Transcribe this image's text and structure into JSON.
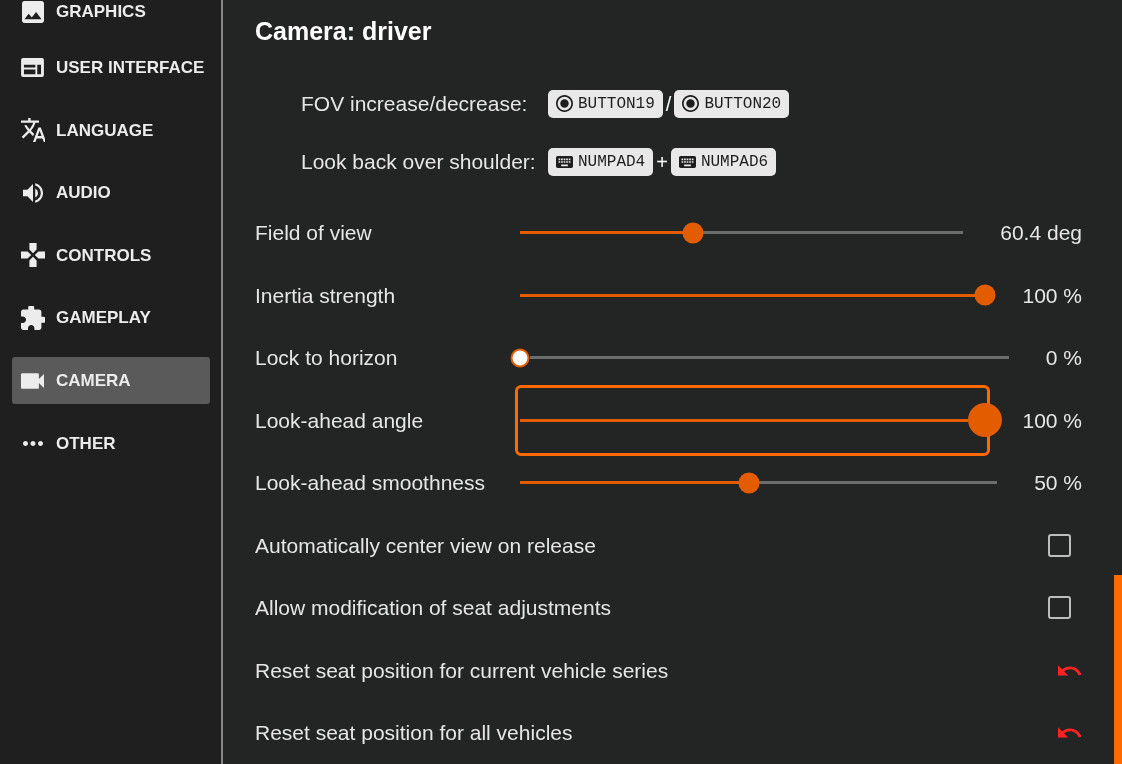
{
  "sidebar": {
    "items": [
      {
        "label": "GRAPHICS",
        "selected": false
      },
      {
        "label": "USER INTERFACE",
        "selected": false
      },
      {
        "label": "LANGUAGE",
        "selected": false
      },
      {
        "label": "AUDIO",
        "selected": false
      },
      {
        "label": "CONTROLS",
        "selected": false
      },
      {
        "label": "GAMEPLAY",
        "selected": false
      },
      {
        "label": "CAMERA",
        "selected": true
      },
      {
        "label": "OTHER",
        "selected": false
      }
    ]
  },
  "section": {
    "title": "Camera: driver"
  },
  "keybindings": [
    {
      "label": "FOV increase/decrease:",
      "keys": [
        {
          "kind": "joystick",
          "label": "BUTTON19"
        },
        {
          "kind": "joystick",
          "label": "BUTTON20"
        }
      ],
      "separator": "/"
    },
    {
      "label": "Look back over shoulder:",
      "keys": [
        {
          "kind": "keyboard",
          "label": "NUMPAD4"
        },
        {
          "kind": "keyboard",
          "label": "NUMPAD6"
        }
      ],
      "separator": "+"
    }
  ],
  "settings": [
    {
      "kind": "slider",
      "label": "Field of view",
      "level": 0.39,
      "reading": "60.4 deg",
      "focused": false
    },
    {
      "kind": "slider",
      "label": "Inertia strength",
      "level": 1,
      "reading": "100 %",
      "focused": false
    },
    {
      "kind": "slider",
      "label": "Lock to horizon",
      "level": 0,
      "reading": "0 %",
      "focused": false
    },
    {
      "kind": "slider",
      "label": "Look-ahead angle",
      "level": 1,
      "reading": "100 %",
      "focused": true
    },
    {
      "kind": "slider",
      "label": "Look-ahead smoothness",
      "level": 0.48,
      "reading": "50 %",
      "focused": false
    },
    {
      "kind": "checkbox",
      "label": "Automatically center view on release",
      "checked": false
    },
    {
      "kind": "checkbox",
      "label": "Allow modification of seat adjustments",
      "checked": false
    },
    {
      "kind": "reset",
      "label": "Reset seat position for current vehicle series"
    },
    {
      "kind": "reset",
      "label": "Reset seat position for all vehicles"
    }
  ]
}
